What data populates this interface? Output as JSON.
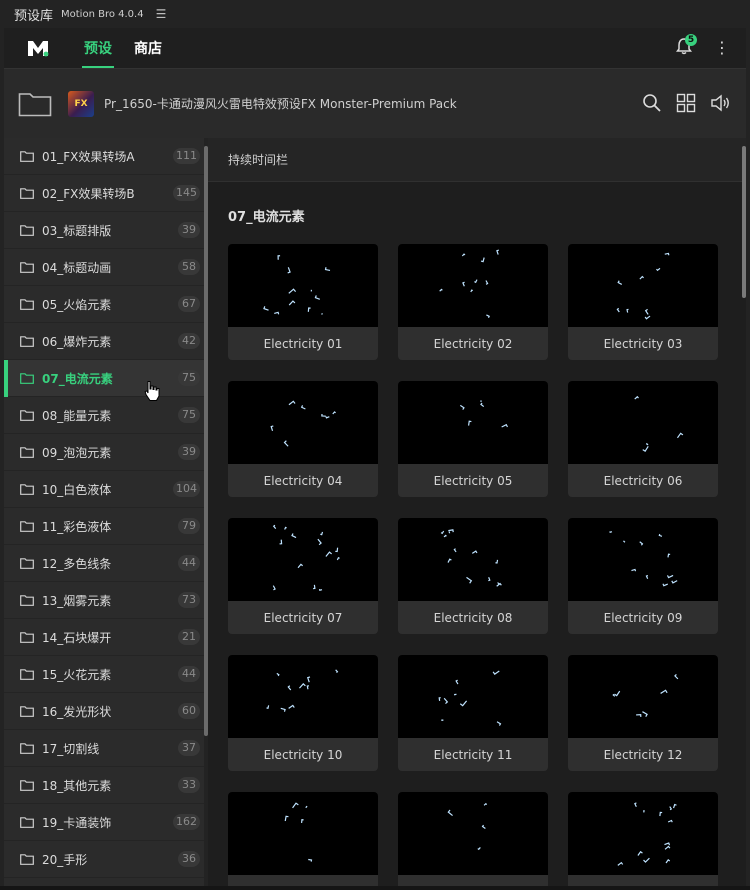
{
  "titlebar": {
    "title": "预设库",
    "app": "Motion Bro 4.0.4",
    "menu_icon": "hamburger-icon"
  },
  "header": {
    "logo": "M",
    "tabs": [
      {
        "label": "预设",
        "active": true
      },
      {
        "label": "商店",
        "active": false
      }
    ],
    "notification_count": "5",
    "accent": "#38d17e"
  },
  "pack": {
    "title": "Pr_1650-卡通动漫风火雷电特效预设FX Monster-Premium Pack",
    "thumb_text": "FX"
  },
  "sidebar": {
    "items": [
      {
        "label": "01_FX效果转场A",
        "count": "111"
      },
      {
        "label": "02_FX效果转场B",
        "count": "145"
      },
      {
        "label": "03_标题排版",
        "count": "39"
      },
      {
        "label": "04_标题动画",
        "count": "58"
      },
      {
        "label": "05_火焰元素",
        "count": "67"
      },
      {
        "label": "06_爆炸元素",
        "count": "42"
      },
      {
        "label": "07_电流元素",
        "count": "75",
        "active": true
      },
      {
        "label": "08_能量元素",
        "count": "75"
      },
      {
        "label": "09_泡泡元素",
        "count": "39"
      },
      {
        "label": "10_白色液体",
        "count": "104"
      },
      {
        "label": "11_彩色液体",
        "count": "79"
      },
      {
        "label": "12_多色线条",
        "count": "44"
      },
      {
        "label": "13_烟雾元素",
        "count": "73"
      },
      {
        "label": "14_石块爆开",
        "count": "21"
      },
      {
        "label": "15_火花元素",
        "count": "44"
      },
      {
        "label": "16_发光形状",
        "count": "60"
      },
      {
        "label": "17_切割线",
        "count": "37"
      },
      {
        "label": "18_其他元素",
        "count": "33"
      },
      {
        "label": "19_卡通装饰",
        "count": "162"
      },
      {
        "label": "20_手形",
        "count": "36"
      }
    ]
  },
  "main": {
    "timeline_label": "持续时间栏",
    "section_title": "07_电流元素",
    "cards": [
      {
        "name": "Electricity 01"
      },
      {
        "name": "Electricity 02"
      },
      {
        "name": "Electricity 03"
      },
      {
        "name": "Electricity 04"
      },
      {
        "name": "Electricity 05"
      },
      {
        "name": "Electricity 06"
      },
      {
        "name": "Electricity 07"
      },
      {
        "name": "Electricity 08"
      },
      {
        "name": "Electricity 09"
      },
      {
        "name": "Electricity 10"
      },
      {
        "name": "Electricity 11"
      },
      {
        "name": "Electricity 12"
      },
      {
        "name": ""
      },
      {
        "name": ""
      },
      {
        "name": ""
      }
    ]
  }
}
